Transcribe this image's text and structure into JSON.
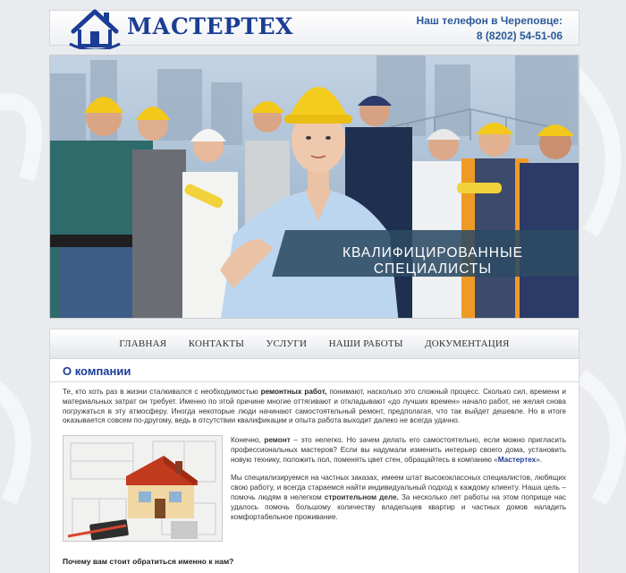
{
  "header": {
    "logo_text": "МАСТЕРТЕХ",
    "phone_label": "Наш телефон в Череповце:",
    "phone_number": "8 (8202) 54-51-06"
  },
  "banner": {
    "caption": "КВАЛИФИЦИРОВАННЫЕ  СПЕЦИАЛИСТЫ"
  },
  "nav": {
    "items": [
      "ГЛАВНАЯ",
      "КОНТАКТЫ",
      "УСЛУГИ",
      "НАШИ РАБОТЫ",
      "ДОКУМЕНТАЦИЯ"
    ]
  },
  "about": {
    "title": "О компании",
    "p1_a": "Те, кто хоть раз в жизни сталкивался с необходимостью ",
    "p1_b": "ремонтных работ,",
    "p1_c": " понимают, насколько это сложный процесс. Сколько сил, времени и материальных затрат он требует. Именно по этой причине многие оттягивают и откладывают «до лучших времен» начало работ, не желая снова погружаться в эту атмосферу. Иногда некоторые люди начинают самостоятельный ремонт, предполагая, что так выйдет дешевле. Но в итоге оказывается совсем по-другому, ведь в отсутствии квалификации и опыта работа выходит далеко не всегда удачно.",
    "p2_a": "Конечно, ",
    "p2_b": "ремонт",
    "p2_c": " – это нелегко. Но зачем делать его самостоятельно, если можно пригласить профессиональных мастеров? Если вы надумали изменить интерьер своего дома, установить новую технику, положить пол, поменять цвет стен, обращайтесь в компанию «",
    "p2_link": "Мастертех",
    "p2_d": "».",
    "p3_a": "Мы специализируемся на частных заказах, имеем штат высококлассных специалистов, любящих свою работу, и всегда стараемся найти индивидуальный подход к каждому клиенту. Наша цель – помочь людям в нелегком ",
    "p3_b": "строительном деле.",
    "p3_c": " За несколько лет работы на этом поприще нас удалось помочь большому количеству владельцев квартир и частных домов наладить комфортабельное проживание.",
    "why_title": "Почему вам стоит обратиться именно к нам?"
  },
  "colors": {
    "brand": "#1b3d94",
    "phone": "#2a5a9a",
    "caption_band": "#2c4a63",
    "helmet": "#f2c81a"
  }
}
